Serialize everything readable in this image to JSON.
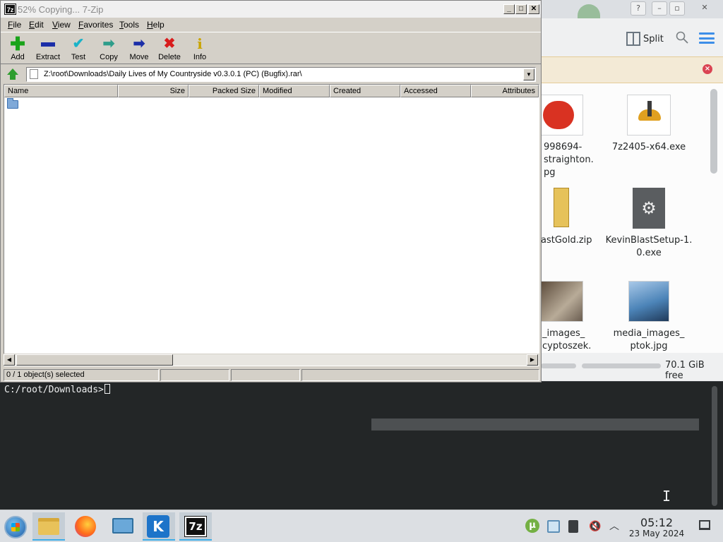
{
  "zip_window": {
    "title": "52% Copying... 7-Zip",
    "logo_text": "7z",
    "menu": [
      "File",
      "Edit",
      "View",
      "Favorites",
      "Tools",
      "Help"
    ],
    "toolbar": [
      {
        "label": "Add",
        "icon": "plus-icon",
        "color": "#1aa31a"
      },
      {
        "label": "Extract",
        "icon": "minus-icon",
        "color": "#1b2ea8"
      },
      {
        "label": "Test",
        "icon": "check-icon",
        "color": "#1ab3c8"
      },
      {
        "label": "Copy",
        "icon": "copy-arrow-icon",
        "color": "#2e9d8a"
      },
      {
        "label": "Move",
        "icon": "move-arrow-icon",
        "color": "#1b2ea8"
      },
      {
        "label": "Delete",
        "icon": "x-icon",
        "color": "#d81c1c"
      },
      {
        "label": "Info",
        "icon": "info-icon",
        "color": "#c9a400"
      }
    ],
    "address": "Z:\\root\\Downloads\\Daily Lives of My Countryside v0.3.0.1 (PC) (Bugfix).rar\\",
    "columns": [
      "Name",
      "Size",
      "Packed Size",
      "Modified",
      "Created",
      "Accessed",
      "Attributes"
    ],
    "status": "0 / 1 object(s) selected"
  },
  "file_manager": {
    "split_label": "Split",
    "files": [
      {
        "name": "998694-\nstraighton.\npg",
        "thumb_color": "#d93222"
      },
      {
        "name": "7z2405-x64.exe",
        "thumb_color": "#e0a020"
      },
      {
        "name": "astGold.zip",
        "thumb_color": "#d9b64a"
      },
      {
        "name": "KevinBlastSetup-1.\n0.exe",
        "thumb_color": "#5a5d60"
      },
      {
        "name": "_images_\ncyptoszek.",
        "thumb_color": "#8a7a66"
      },
      {
        "name": "media_images_\nptok.jpg",
        "thumb_color": "#4c84b8"
      }
    ],
    "free_space": "70.1 GiB free"
  },
  "terminal": {
    "prompt": "C:/root/Downloads>"
  },
  "taskbar": {
    "time": "05:12",
    "date": "23 May 2024",
    "tray_torrent": "µ",
    "kde_glyph": "K",
    "zip_glyph": "7z"
  }
}
